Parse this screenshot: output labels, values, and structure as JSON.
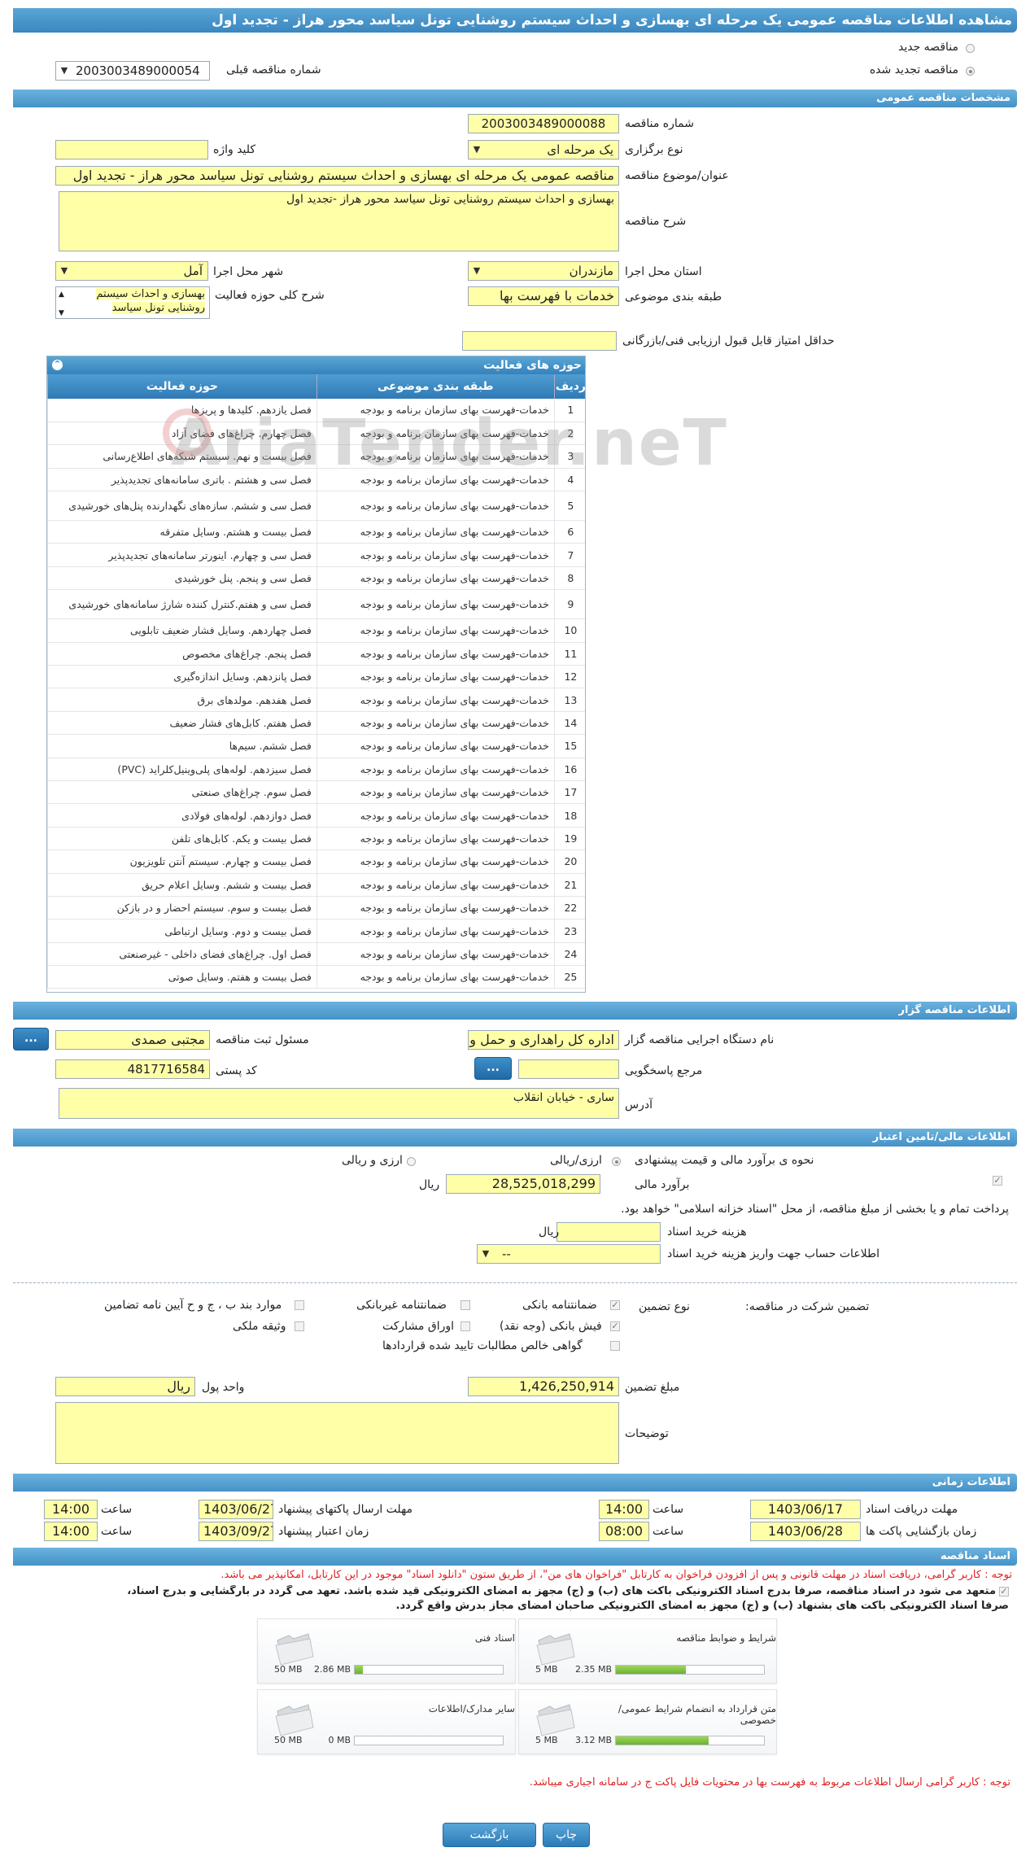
{
  "title": "مشاهده اطلاعات مناقصه عمومی یک مرحله ای بهسازی و احداث سیستم روشنایی تونل سیاسد محور هراز - تجدید اول",
  "tender_type_options": {
    "new": "مناقصه جدید",
    "renewed": "مناقصه تجدید شده"
  },
  "previous_tender": {
    "label": "شماره مناقصه قبلی",
    "value": "2003003489000054"
  },
  "sections": {
    "general": "مشخصات مناقصه عمومی",
    "organizer": "اطلاعات مناقصه گزار",
    "financial": "اطلاعات مالی/تامین اعتبار",
    "timing": "اطلاعات زمانی",
    "documents": "اسناد مناقصه"
  },
  "general": {
    "number_label": "شماره مناقصه",
    "number": "2003003489000088",
    "holding_type_label": "نوع برگزاری",
    "holding_type": "یک مرحله ای",
    "keyword_label": "کلید واژه",
    "keyword": "",
    "subject_label": "عنوان/موضوع مناقصه",
    "subject": "مناقصه عمومی یک مرحله ای بهسازی و احداث سیستم روشنایی تونل سیاسد محور هراز - تجدید اول",
    "description_label": "شرح مناقصه",
    "description": "بهسازی و احداث سیستم روشنایی تونل سیاسد محور هراز -تجدید اول",
    "province_label": "استان محل اجرا",
    "province": "مازندران",
    "city_label": "شهر محل اجرا",
    "city": "آمل",
    "category_label": "طبقه بندی موضوعی",
    "category": "خدمات با فهرست بها",
    "activity_desc_label": "شرح کلی حوزه فعالیت",
    "activity_desc": "بهسازی و احداث سیستم روشنایی تونل سیاسد",
    "min_score_label": "حداقل امتیاز قابل قبول ارزیابی فنی/بازرگانی",
    "min_score": ""
  },
  "activity_grid": {
    "title": "حوزه های فعالیت",
    "headers": {
      "row": "ردیف",
      "category": "طبقه بندی موضوعی",
      "activity": "حوزه فعالیت"
    },
    "rows": [
      {
        "n": "1",
        "category": "خدمات-فهرست بهای سازمان برنامه و بودجه",
        "activity": "فصل یازدهم. کلیدها و پریزها"
      },
      {
        "n": "2",
        "category": "خدمات-فهرست بهای سازمان برنامه و بودجه",
        "activity": "فصل چهارم. چراغ‌های فضای آزاد"
      },
      {
        "n": "3",
        "category": "خدمات-فهرست بهای سازمان برنامه و بودجه",
        "activity": "فصل بیست و نهم. سیستم شبکه‌های اطلاع‌رسانی"
      },
      {
        "n": "4",
        "category": "خدمات-فهرست بهای سازمان برنامه و بودجه",
        "activity": "فصل سی و هشتم . باتری سامانه‌های تجدیدپذیر"
      },
      {
        "n": "5",
        "category": "خدمات-فهرست بهای سازمان برنامه و بودجه",
        "activity": "فصل سی و ششم. سازه‌های نگهدارنده پنل‌های خورشیدی",
        "tall": true
      },
      {
        "n": "6",
        "category": "خدمات-فهرست بهای سازمان برنامه و بودجه",
        "activity": "فصل بیست و هشتم. وسایل متفرقه"
      },
      {
        "n": "7",
        "category": "خدمات-فهرست بهای سازمان برنامه و بودجه",
        "activity": "فصل سی و چهارم. اینورتر سامانه‌های تجدیدپذیر"
      },
      {
        "n": "8",
        "category": "خدمات-فهرست بهای سازمان برنامه و بودجه",
        "activity": "فصل سی و پنجم. پنل خورشیدی"
      },
      {
        "n": "9",
        "category": "خدمات-فهرست بهای سازمان برنامه و بودجه",
        "activity": "فصل سی و هفتم.کنترل کننده شارژ سامانه‌های خورشیدی",
        "tall": true
      },
      {
        "n": "10",
        "category": "خدمات-فهرست بهای سازمان برنامه و بودجه",
        "activity": "فصل چهاردهم. وسایل فشار ضعیف تابلویی"
      },
      {
        "n": "11",
        "category": "خدمات-فهرست بهای سازمان برنامه و بودجه",
        "activity": "فصل پنجم. چراغ‌های مخصوص"
      },
      {
        "n": "12",
        "category": "خدمات-فهرست بهای سازمان برنامه و بودجه",
        "activity": "فصل پانزدهم. وسایل اندازه‌گیری"
      },
      {
        "n": "13",
        "category": "خدمات-فهرست بهای سازمان برنامه و بودجه",
        "activity": "فصل هفدهم. مولدهای برق"
      },
      {
        "n": "14",
        "category": "خدمات-فهرست بهای سازمان برنامه و بودجه",
        "activity": "فصل هفتم. کابل‌های فشار ضعیف"
      },
      {
        "n": "15",
        "category": "خدمات-فهرست بهای سازمان برنامه و بودجه",
        "activity": "فصل ششم. سیم‌ها"
      },
      {
        "n": "16",
        "category": "خدمات-فهرست بهای سازمان برنامه و بودجه",
        "activity": "فصل سیزدهم. لوله‌های پلی‌وینیل‌کلراید (PVC)"
      },
      {
        "n": "17",
        "category": "خدمات-فهرست بهای سازمان برنامه و بودجه",
        "activity": "فصل سوم. چراغ‌های صنعتی"
      },
      {
        "n": "18",
        "category": "خدمات-فهرست بهای سازمان برنامه و بودجه",
        "activity": "فصل دوازدهم. لوله‌های فولادی"
      },
      {
        "n": "19",
        "category": "خدمات-فهرست بهای سازمان برنامه و بودجه",
        "activity": "فصل بیست و یکم. کابل‌های تلفن"
      },
      {
        "n": "20",
        "category": "خدمات-فهرست بهای سازمان برنامه و بودجه",
        "activity": "فصل بیست و چهارم. سیستم آنتن تلویزیون"
      },
      {
        "n": "21",
        "category": "خدمات-فهرست بهای سازمان برنامه و بودجه",
        "activity": "فصل بیست و ششم. وسایل اعلام حریق"
      },
      {
        "n": "22",
        "category": "خدمات-فهرست بهای سازمان برنامه و بودجه",
        "activity": "فصل بیست و سوم. سیستم احضار و در بازکن"
      },
      {
        "n": "23",
        "category": "خدمات-فهرست بهای سازمان برنامه و بودجه",
        "activity": "فصل بیست و دوم. وسایل ارتباطی"
      },
      {
        "n": "24",
        "category": "خدمات-فهرست بهای سازمان برنامه و بودجه",
        "activity": "فصل اول. چراغ‌های فضای داخلی - غیرصنعتی"
      },
      {
        "n": "25",
        "category": "خدمات-فهرست بهای سازمان برنامه و بودجه",
        "activity": "فصل بیست و هفتم. وسایل صوتی"
      }
    ]
  },
  "watermark": "AriaTender.neT",
  "organizer": {
    "agency_label": "نام دستگاه اجرایی مناقصه گزار",
    "agency": "اداره کل راهداری و حمل و نقل",
    "responsible_label": "مسئول ثبت مناقصه",
    "responsible": "مجتبی صمدی",
    "reference_label": "مرجع پاسخگویی",
    "reference": "",
    "postal_label": "کد پستی",
    "postal": "4817716584",
    "address_label": "آدرس",
    "address": "ساری - خیابان  انقلاب",
    "dots": "..."
  },
  "financial": {
    "estimate_method_label": "نحوه ی برآورد مالی و قیمت پیشنهادی",
    "currency_rial": "ارزی/ریالی",
    "currency_both": "ارزی و ریالی",
    "estimate_label": "برآورد مالی",
    "estimate": "28,525,018,299",
    "rial": "ریال",
    "treasury_note": "پرداخت تمام و یا بخشی از مبلغ مناقصه، از محل \"اسناد خزانه اسلامی\" خواهد بود.",
    "doc_fee_label": "هزینه خرید اسناد",
    "doc_fee": "",
    "account_label": "اطلاعات حساب جهت واریز هزینه خرید اسناد",
    "account": "--",
    "guarantee_title": "تضمین شرکت در مناقصه:",
    "guarantee_type_label": "نوع تضمین",
    "guarantees": {
      "bank": "ضمانتنامه بانکی",
      "nonbank": "ضمانتنامه غیربانکی",
      "clause": "موارد بند ب ، ج و ح آیین نامه تضامین",
      "cheque": "فیش بانکی (وجه نقد)",
      "bonds": "اوراق مشارکت",
      "property": "وثیقه ملکی",
      "claims": "گواهی خالص مطالبات تایید شده قراردادها"
    },
    "guarantee_amount_label": "مبلغ تضمین",
    "guarantee_amount": "1,426,250,914",
    "currency_unit_label": "واحد پول",
    "currency_unit": "ریال",
    "notes_label": "توضیحات",
    "notes": ""
  },
  "timing": {
    "receive_deadline_label": "مهلت دریافت اسناد",
    "receive_deadline_date": "1403/06/17",
    "receive_deadline_time": "14:00",
    "send_deadline_label": "مهلت ارسال پاکتهای پیشنهاد",
    "send_deadline_date": "1403/06/27",
    "send_deadline_time": "14:00",
    "open_label": "زمان بازگشایی پاکت ها",
    "open_date": "1403/06/28",
    "open_time": "08:00",
    "validity_label": "زمان اعتبار پیشنهاد",
    "validity_date": "1403/09/27",
    "validity_time": "14:00",
    "time_label": "ساعت"
  },
  "documents": {
    "notice": "توجه : کاربر گرامی، دریافت اسناد در مهلت قانونی و پس از افزودن فراخوان به کارتابل \"فراخوان های من\"، از طریق ستون \"دانلود اسناد\" موجود در این کارتابل، امکانپذیر می باشد.",
    "commit_1": "متعهد می شود در اسناد مناقصه، صرفاً بدرج اسناد الکترونیکی باکت های (ب) و (ج) مجهز به امضای الکترونیکی قید شده باشد. تعهد می گردد در بارگشایی و بدرج اسناد،",
    "commit_2": "صرفاً اسناد الکترونیکی باکت های بشنهاد (ب) و (ج) مجهز به امضای الکترونیکی صاحبان امضای مجاز بدرش واقع گردد.",
    "items": [
      {
        "name": "شرایط و ضوابط مناقصه",
        "current": "2.35 MB",
        "max": "5 MB",
        "fraction": 0.47
      },
      {
        "name": "اسناد فنی",
        "current": "2.86 MB",
        "max": "50 MB",
        "fraction": 0.057
      },
      {
        "name": "متن قرارداد به انضمام شرایط عمومی/خصوصی",
        "current": "3.12 MB",
        "max": "5 MB",
        "fraction": 0.624
      },
      {
        "name": "سایر مدارک/اطلاعات",
        "current": "0 MB",
        "max": "50 MB",
        "fraction": 0
      }
    ],
    "footer_note": "توجه : کاربر گرامی ارسال اطلاعات مربوط به فهرست بها در محتویات فایل پاکت ج در سامانه اجباری میباشد."
  },
  "buttons": {
    "print": "چاپ",
    "back": "بازگشت"
  }
}
